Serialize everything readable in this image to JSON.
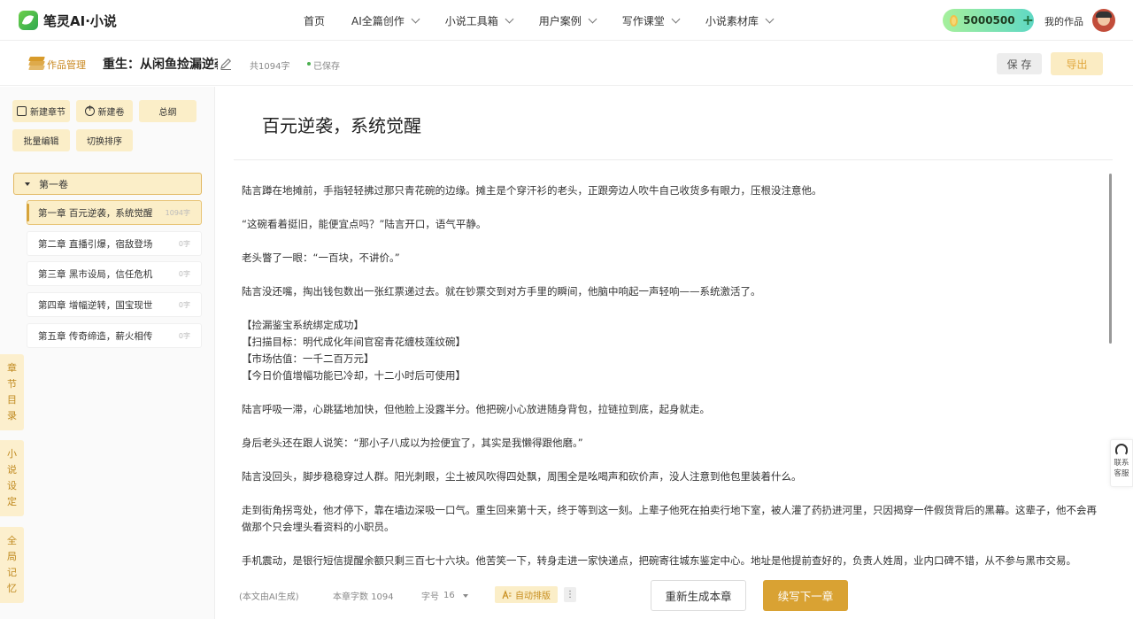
{
  "app": {
    "name": "笔灵AI·小说"
  },
  "nav": {
    "items": [
      {
        "label": "首页",
        "has_dropdown": false
      },
      {
        "label": "AI全篇创作",
        "has_dropdown": true
      },
      {
        "label": "小说工具箱",
        "has_dropdown": true
      },
      {
        "label": "用户案例",
        "has_dropdown": true
      },
      {
        "label": "写作课堂",
        "has_dropdown": true
      },
      {
        "label": "小说素材库",
        "has_dropdown": true
      }
    ],
    "coins": "5000500",
    "coins_plus": "+",
    "my_works": "我的作品"
  },
  "subheader": {
    "work_manage": "作品管理",
    "book_title": "重生：从闲鱼捡漏逆袭",
    "word_total": "共1094字",
    "saved": "已保存",
    "save_btn": "保 存",
    "export_btn": "导出"
  },
  "sidebar": {
    "tools": [
      "新建章节",
      "新建卷",
      "总纲",
      "批量编辑",
      "切换排序"
    ],
    "volume": "第一卷",
    "chapters": [
      {
        "title": "第一章 百元逆袭，系统觉醒",
        "count": "1094字",
        "active": true
      },
      {
        "title": "第二章 直播引爆，宿敌登场",
        "count": "0字",
        "active": false
      },
      {
        "title": "第三章 黑市设局，信任危机",
        "count": "0字",
        "active": false
      },
      {
        "title": "第四章 增幅逆转，国宝现世",
        "count": "0字",
        "active": false
      },
      {
        "title": "第五章 传奇缔造，薪火相传",
        "count": "0字",
        "active": false
      }
    ],
    "vtabs": [
      "章节目录",
      "小说设定",
      "全局记忆"
    ]
  },
  "editor": {
    "chapter_title": "百元逆袭，系统觉醒",
    "paragraphs": [
      "陆言蹲在地摊前，手指轻轻拂过那只青花碗的边缘。摊主是个穿汗衫的老头，正跟旁边人吹牛自己收货多有眼力，压根没注意他。",
      "“这碗看着挺旧，能便宜点吗？”陆言开口，语气平静。",
      "老头瞥了一眼：“一百块，不讲价。”",
      "陆言没还嘴，掏出钱包数出一张红票递过去。就在钞票交到对方手里的瞬间，他脑中响起一声轻响——系统激活了。",
      "【捡漏鉴宝系统绑定成功】",
      "【扫描目标：明代成化年间官窑青花缠枝莲纹碗】",
      "【市场估值：一千二百万元】",
      "【今日价值增幅功能已冷却，十二小时后可使用】",
      "陆言呼吸一滞，心跳猛地加快，但他脸上没露半分。他把碗小心放进随身背包，拉链拉到底，起身就走。",
      "身后老头还在跟人说笑：“那小子八成以为捡便宜了，其实是我懒得跟他磨。”",
      "陆言没回头，脚步稳稳穿过人群。阳光刺眼，尘土被风吹得四处飘，周围全是吆喝声和砍价声，没人注意到他包里装着什么。",
      "走到街角拐弯处，他才停下，靠在墙边深吸一口气。重生回来第十天，终于等到这一刻。上辈子他死在拍卖行地下室，被人灌了药扔进河里，只因揭穿一件假货背后的黑幕。这辈子，他不会再做那个只会埋头看资料的小职员。",
      "手机震动，是银行短信提醒余额只剩三百七十六块。他苦笑一下，转身走进一家快递点，把碗寄往城东鉴定中心。地址是他提前查好的，负责人姓周，业内口碑不错，从不参与黑市交易。"
    ]
  },
  "bottom": {
    "note": "(本文由AI生成)",
    "chapter_words_label": "本章字数",
    "chapter_words": "1094",
    "font_label": "字号",
    "font_size": "16",
    "auto_format": "自动排版",
    "more": "⋮",
    "regen": "重新生成本章",
    "next": "续写下一章"
  },
  "contact": {
    "line1": "联系",
    "line2": "客服"
  },
  "colors": {
    "accent": "#d9a233",
    "accent_light": "#fbeec8",
    "coin_gradient_start": "#a6f09c",
    "coin_gradient_end": "#5fd8c4"
  }
}
